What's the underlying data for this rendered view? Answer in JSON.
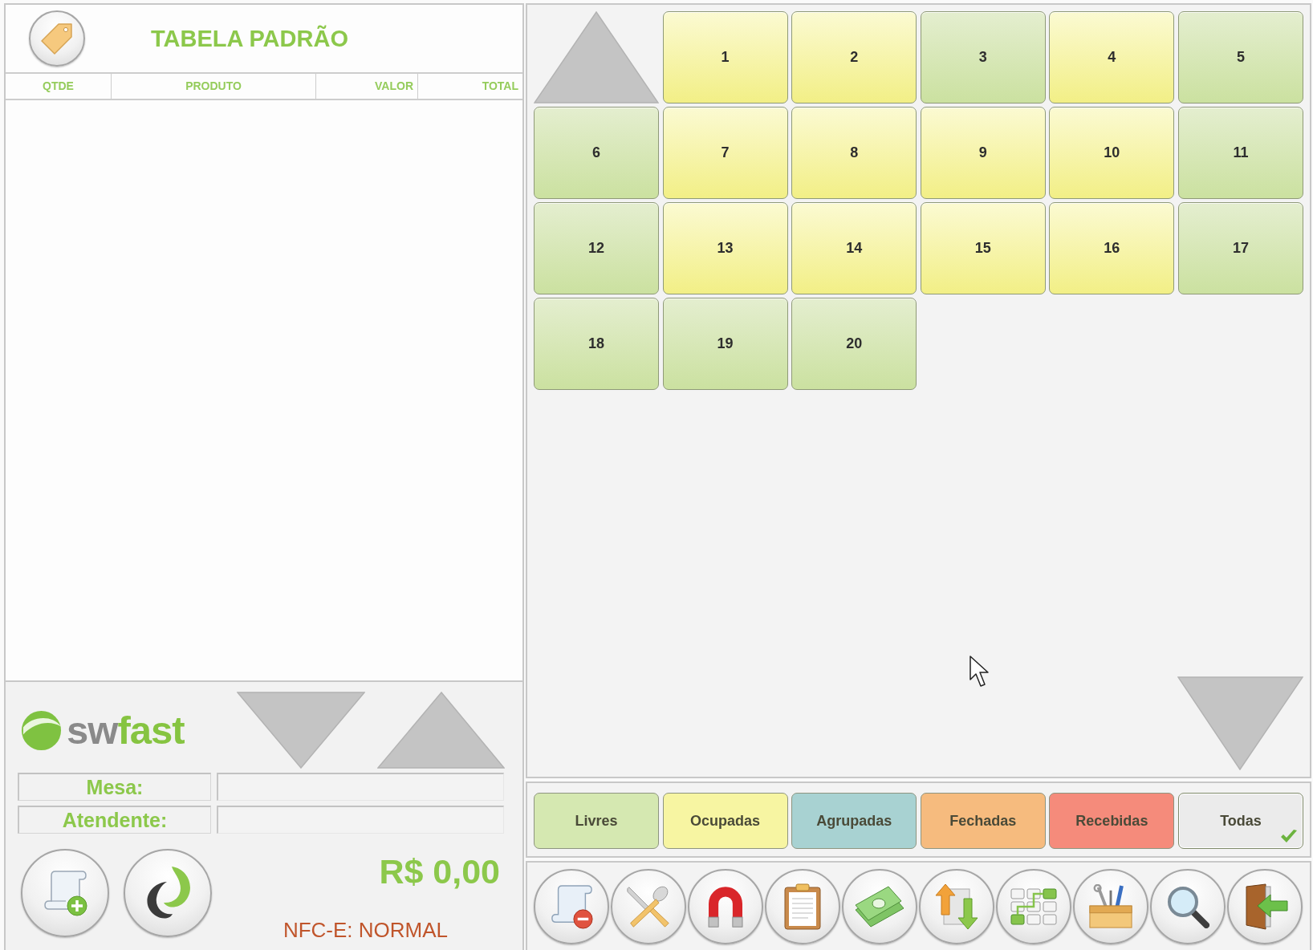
{
  "header": {
    "title": "TABELA PADRÃO"
  },
  "order_table": {
    "columns": [
      "QTDE",
      "PRODUTO",
      "VALOR",
      "TOTAL"
    ]
  },
  "logo": {
    "parts": [
      "sw",
      "fast"
    ]
  },
  "info_fields": [
    {
      "label": "Mesa:"
    },
    {
      "label": "Atendente:"
    }
  ],
  "total": "R$ 0,00",
  "nfce_status": "NFC-E: NORMAL",
  "tables": [
    {
      "number": "1",
      "occupied": true
    },
    {
      "number": "2",
      "occupied": true
    },
    {
      "number": "3",
      "occupied": false
    },
    {
      "number": "4",
      "occupied": true
    },
    {
      "number": "5",
      "occupied": false
    },
    {
      "number": "6",
      "occupied": false
    },
    {
      "number": "7",
      "occupied": true
    },
    {
      "number": "8",
      "occupied": true
    },
    {
      "number": "9",
      "occupied": true
    },
    {
      "number": "10",
      "occupied": true
    },
    {
      "number": "11",
      "occupied": false
    },
    {
      "number": "12",
      "occupied": false
    },
    {
      "number": "13",
      "occupied": true
    },
    {
      "number": "14",
      "occupied": true
    },
    {
      "number": "15",
      "occupied": true
    },
    {
      "number": "16",
      "occupied": true
    },
    {
      "number": "17",
      "occupied": false
    },
    {
      "number": "18",
      "occupied": false
    },
    {
      "number": "19",
      "occupied": false
    },
    {
      "number": "20",
      "occupied": false
    }
  ],
  "filters": [
    {
      "label": "Livres",
      "color": "#d5e8b1",
      "selected": false
    },
    {
      "label": "Ocupadas",
      "color": "#f7f5a2",
      "selected": false
    },
    {
      "label": "Agrupadas",
      "color": "#a8d2d2",
      "selected": false
    },
    {
      "label": "Fechadas",
      "color": "#f6bb7e",
      "selected": false
    },
    {
      "label": "Recebidas",
      "color": "#f58b7b",
      "selected": false
    },
    {
      "label": "Todas",
      "color": "#ebebeb",
      "selected": true
    }
  ]
}
